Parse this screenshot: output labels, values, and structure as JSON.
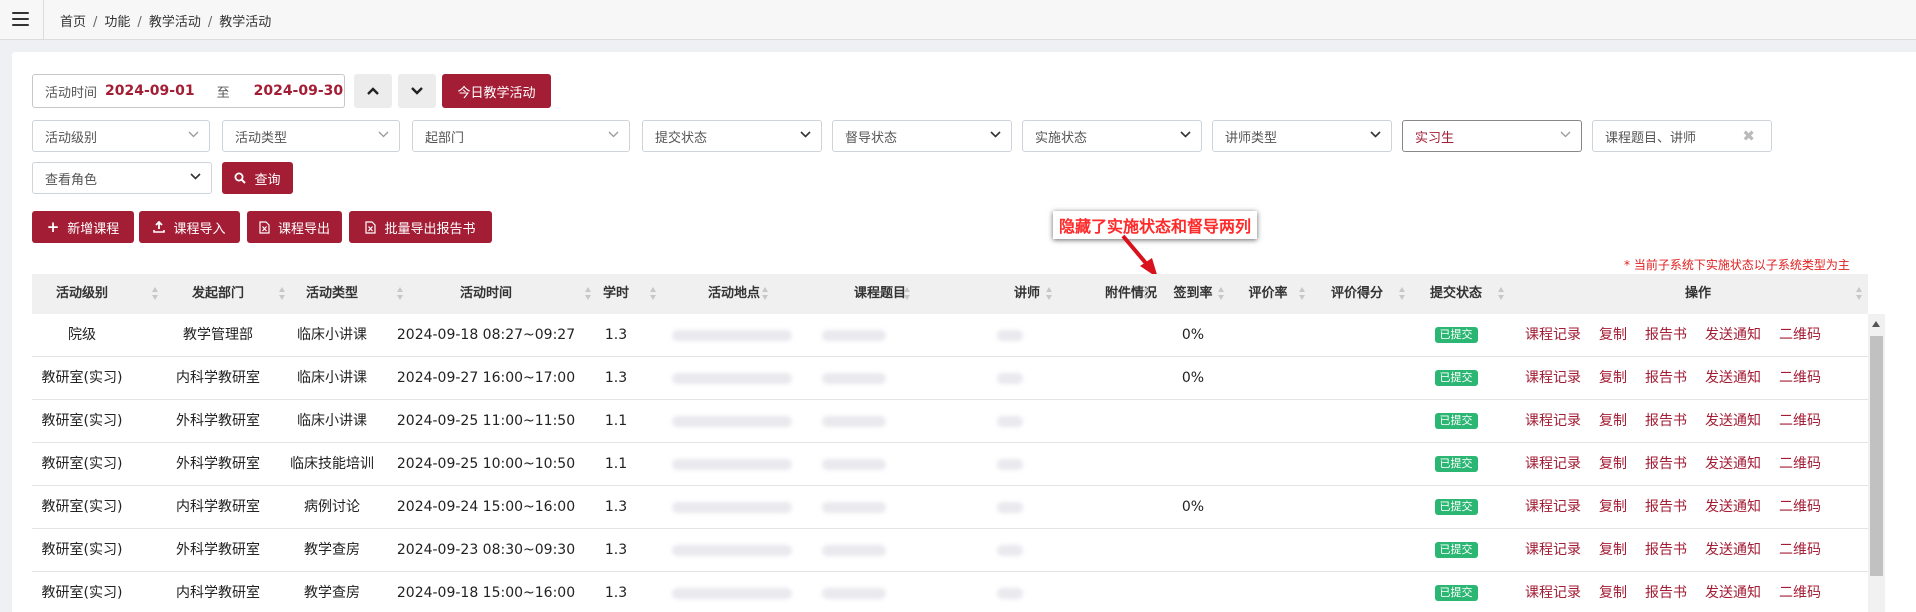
{
  "breadcrumb": [
    "首页",
    "功能",
    "教学活动",
    "教学活动"
  ],
  "date_filter": {
    "label": "活动时间",
    "start": "2024-09-01",
    "separator": "至",
    "end": "2024-09-30"
  },
  "buttons": {
    "today": "今日教学活动",
    "query": "查询",
    "add_course": "新增课程",
    "import_course": "课程导入",
    "export_course": "课程导出",
    "batch_export": "批量导出报告书"
  },
  "filters": {
    "level": "活动级别",
    "type": "活动类型",
    "department": "起部门",
    "submit_status": "提交状态",
    "supervise_status": "督导状态",
    "implement_status": "实施状态",
    "lecturer_type": "讲师类型",
    "trainee": "实习生",
    "search_placeholder": "课程题目、讲师",
    "view_role": "查看角色"
  },
  "annotation": "隐藏了实施状态和督导两列",
  "note": "* 当前子系统下实施状态以子系统类型为主",
  "table": {
    "columns": {
      "level": "活动级别",
      "dept": "发起部门",
      "type": "活动类型",
      "time": "活动时间",
      "hours": "学时",
      "place": "活动地点",
      "topic": "课程题目",
      "lecturer": "讲师",
      "attach": "附件情况",
      "signin": "签到率",
      "eval_rate": "评价率",
      "eval_score": "评价得分",
      "submit": "提交状态",
      "ops": "操作"
    },
    "rows": [
      {
        "level": "院级",
        "dept": "教学管理部",
        "type": "临床小讲课",
        "time": "2024-09-18 08:27~09:27",
        "hours": "1.3",
        "signin": "0%",
        "submit": "已提交"
      },
      {
        "level": "教研室(实习)",
        "dept": "内科学教研室",
        "type": "临床小讲课",
        "time": "2024-09-27 16:00~17:00",
        "hours": "1.3",
        "signin": "0%",
        "submit": "已提交"
      },
      {
        "level": "教研室(实习)",
        "dept": "外科学教研室",
        "type": "临床小讲课",
        "time": "2024-09-25 11:00~11:50",
        "hours": "1.1",
        "signin": "",
        "submit": "已提交"
      },
      {
        "level": "教研室(实习)",
        "dept": "外科学教研室",
        "type": "临床技能培训",
        "time": "2024-09-25 10:00~10:50",
        "hours": "1.1",
        "signin": "",
        "submit": "已提交"
      },
      {
        "level": "教研室(实习)",
        "dept": "内科学教研室",
        "type": "病例讨论",
        "time": "2024-09-24 15:00~16:00",
        "hours": "1.3",
        "signin": "0%",
        "submit": "已提交"
      },
      {
        "level": "教研室(实习)",
        "dept": "外科学教研室",
        "type": "教学查房",
        "time": "2024-09-23 08:30~09:30",
        "hours": "1.3",
        "signin": "",
        "submit": "已提交"
      },
      {
        "level": "教研室(实习)",
        "dept": "内科学教研室",
        "type": "教学查房",
        "time": "2024-09-18 15:00~16:00",
        "hours": "1.3",
        "signin": "",
        "submit": "已提交"
      }
    ],
    "actions": [
      "课程记录",
      "复制",
      "报告书",
      "发送通知",
      "二维码"
    ]
  }
}
